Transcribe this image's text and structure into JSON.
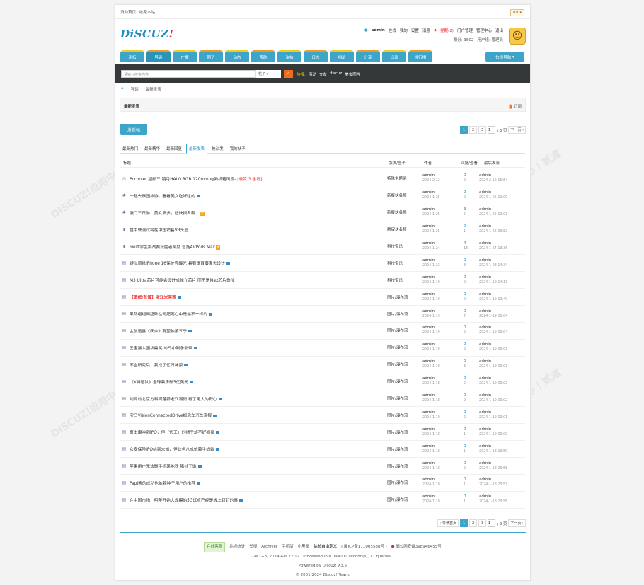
{
  "topbar": {
    "set_home": "设为首页",
    "favorite": "收藏本站",
    "diy": "DIY"
  },
  "logo": {
    "text": "DiSCUZ",
    "bang": "!"
  },
  "user": {
    "name": "admin",
    "status": "在线",
    "mine": "我的",
    "settings": "设置",
    "messages": "消息",
    "remind": "提醒(2)",
    "portal_admin": "门户管理",
    "admin_center": "管理中心",
    "logout": "退出",
    "points": "积分: 3802",
    "group": "用户组: 管理员"
  },
  "nav": [
    "论坛",
    "导读",
    "广播",
    "圈子",
    "动态",
    "帮助",
    "淘帖",
    "日志",
    "相册",
    "分享",
    "记录",
    "排行榜"
  ],
  "quicknav": "快捷导航",
  "search": {
    "placeholder": "请输入搜索内容",
    "type": "帖子",
    "hot_label": "热搜:",
    "hot": [
      "活动",
      "交友",
      "discuz",
      "美女图片"
    ]
  },
  "breadcrumb": [
    "导读",
    "最新发表"
  ],
  "panel": {
    "title": "最新发表",
    "subscribe": "订阅"
  },
  "post_button": "发新帖",
  "pager": {
    "prev": "‹ 导读首页",
    "pages": [
      "1",
      "2",
      "3"
    ],
    "current": "1",
    "total": "/ 3 页",
    "next": "下一页"
  },
  "tabs": [
    "最新热门",
    "最新精华",
    "最新回复",
    "最新发表",
    "抢沙发",
    "我的帖子"
  ],
  "table_head": {
    "title": "标题",
    "forum": "版块/圈子",
    "author": "作者",
    "stats": "回复/查看",
    "last": "最后发表"
  },
  "threads": [
    {
      "icon": "poll",
      "title": "Pccooler 超频三 镜月HALO RGB 120mm 电脑机箱风扇- ",
      "extra": "[悬赏 3 金钱]",
      "forum": "特殊主题贴",
      "author": "admin",
      "date": "2024-2-12",
      "replies": "0",
      "views": "9",
      "last_user": "admin",
      "last_date": "2024-2-12 15:54"
    },
    {
      "icon": "group",
      "title": "一起去泰国旅游，看看美女吃好吃的",
      "pic": true,
      "forum": "新版块名称",
      "author": "admin",
      "date": "2024-1-25",
      "replies": "0",
      "views": "9",
      "last_user": "admin",
      "last_date": "2024-1-25 10:09"
    },
    {
      "icon": "group",
      "title": "澳门三日游，美女多多，赶快报名啊...",
      "tag": "大",
      "forum": "新版块名称",
      "author": "admin",
      "date": "2024-1-25",
      "replies": "3",
      "views": "5",
      "last_user": "admin",
      "last_date": "2024-1-25 10:03"
    },
    {
      "icon": "chart",
      "title": "盘中餐测试将在中国销售VR头显",
      "pic": false,
      "forum": "新版块名称",
      "author": "admin",
      "date": "2024-1-25",
      "replies": "0",
      "views": "1",
      "last_user": "admin",
      "last_date": "2024-1-25 09:52"
    },
    {
      "icon": "chart",
      "title": "Swift学生挑战赛获胜者奖励 包括AirPods Max",
      "tag": "大",
      "forum": "科技资讯",
      "author": "admin",
      "date": "2024-1-24",
      "replies": "4",
      "views": "13",
      "last_user": "admin",
      "last_date": "2024-1-24 13:36"
    },
    {
      "icon": "doc",
      "title": "疑似首批iPhone 16保护壳曝光 具有垂直摄像头设计",
      "pic": true,
      "forum": "科技资讯",
      "author": "admin",
      "date": "2024-1-23",
      "replies": "0",
      "views": "8",
      "last_user": "admin",
      "last_date": "2024-1-23 14:34"
    },
    {
      "icon": "doc",
      "title": "M3 Ultra芯片可能会设计成独立芯片 而不是Max芯片叠加",
      "pic": false,
      "forum": "科技资讯",
      "author": "admin",
      "date": "2024-1-19",
      "replies": "0",
      "views": "9",
      "last_user": "admin",
      "last_date": "2024-1-19 14:13"
    },
    {
      "icon": "doc",
      "title": "【壁纸/背景】浙江米芙茜",
      "red": true,
      "pic": true,
      "forum": "图片/瀑布流",
      "author": "admin",
      "date": "2024-1-19",
      "replies": "0",
      "views": "9",
      "last_user": "admin",
      "last_date": "2024-1-19 19:40"
    },
    {
      "icon": "doc",
      "title": "果然组组何超陆在何超莲心中是最不一样的",
      "pic": true,
      "forum": "图片/瀑布流",
      "author": "admin",
      "date": "2024-1-19",
      "replies": "0",
      "views": "7",
      "last_user": "admin",
      "last_date": "2024-1-19 00:04"
    },
    {
      "icon": "doc",
      "title": "主创透露《庆余》有望拍第五季",
      "pic": true,
      "forum": "图片/瀑布流",
      "author": "admin",
      "date": "2024-1-19",
      "replies": "0",
      "views": "2",
      "last_user": "admin",
      "last_date": "2024-1-19 00:04"
    },
    {
      "icon": "doc",
      "title": "王宝强入围华鼎奖 与马小刚争影帝",
      "pic": true,
      "forum": "图片/瀑布流",
      "author": "admin",
      "date": "2024-1-19",
      "replies": "0",
      "views": "2",
      "last_user": "admin",
      "last_date": "2024-1-19 00:03"
    },
    {
      "icon": "doc",
      "title": "不当研究后，我成了亿万神豪",
      "pic": true,
      "forum": "图片/瀑布流",
      "author": "admin",
      "date": "2024-1-18",
      "replies": "0",
      "views": "3",
      "last_user": "admin",
      "last_date": "2024-1-19 00:03"
    },
    {
      "icon": "doc",
      "title": "《X特遣队》全球票房破5亿美元",
      "pic": true,
      "forum": "图片/瀑布流",
      "author": "admin",
      "date": "2024-1-18",
      "replies": "0",
      "views": "2",
      "last_user": "admin",
      "last_date": "2024-1-19 00:02"
    },
    {
      "icon": "doc",
      "title": "刘局的北京方科周落养老江湖街 有了更大的野心",
      "pic": true,
      "forum": "图片/瀑布流",
      "author": "admin",
      "date": "2024-1-18",
      "replies": "0",
      "views": "2",
      "last_user": "admin",
      "last_date": "2024-1-19 00:02"
    },
    {
      "icon": "doc",
      "title": "宝马VisionConnectedDrive概念车汽车海报",
      "pic": true,
      "forum": "图片/瀑布流",
      "author": "admin",
      "date": "2024-1-19",
      "replies": "0",
      "views": "2",
      "last_user": "admin",
      "last_date": "2024-1-19 00:01"
    },
    {
      "icon": "doc",
      "title": "富士康冲刺IPO，但「代工」的帽子却不好摘掉",
      "pic": true,
      "forum": "图片/瀑布流",
      "author": "admin",
      "date": "2024-1-18",
      "replies": "0",
      "views": "1",
      "last_user": "admin",
      "last_date": "2024-1-19 00:00"
    },
    {
      "icon": "doc",
      "title": "众安保险IPO结果未知，但业务八成依赖生蚂蚁",
      "pic": true,
      "forum": "图片/瀑布流",
      "author": "admin",
      "date": "2024-1-18",
      "replies": "0",
      "views": "1",
      "last_user": "admin",
      "last_date": "2024-1-18 23:59"
    },
    {
      "icon": "doc",
      "title": "苹果用户无法删手机果地铁 猪扯了谁",
      "pic": true,
      "forum": "图片/瀑布流",
      "author": "admin",
      "date": "2024-1-18",
      "replies": "0",
      "views": "2",
      "last_user": "admin",
      "last_date": "2024-1-18 23:58"
    },
    {
      "icon": "doc",
      "title": "Papi酱的成功也依赖种子用户的推荐",
      "pic": true,
      "forum": "图片/瀑布流",
      "author": "admin",
      "date": "2024-1-18",
      "replies": "0",
      "views": "1",
      "last_user": "admin",
      "last_date": "2024-1-18 23:57"
    },
    {
      "icon": "doc",
      "title": "在中国市场，明年开始大规模的5G试点已经是板上钉钉的事",
      "pic": true,
      "forum": "图片/瀑布流",
      "author": "admin",
      "date": "2024-1-18",
      "replies": "0",
      "views": "1",
      "last_user": "admin",
      "last_date": "2024-1-18 23:56"
    }
  ],
  "footer": {
    "online": "在线客服",
    "links": [
      "站点统计",
      "举报",
      "Archiver",
      "手机版",
      "小黑屋"
    ],
    "custom": "站长自由定义",
    "icp": "( 闽ICP备111005588号 )",
    "police": "闽公网安备398946455号",
    "gmt": "GMT+8, 2024-4-6 22:12 , Processed in 0.094000 second(s), 17 queries .",
    "powered": "Powered by Discuz! X3.5",
    "copyright": "© 2001-2024 Discuz! Team."
  },
  "watermark": "DISCUZ!应用中心 addon.dismall.com"
}
